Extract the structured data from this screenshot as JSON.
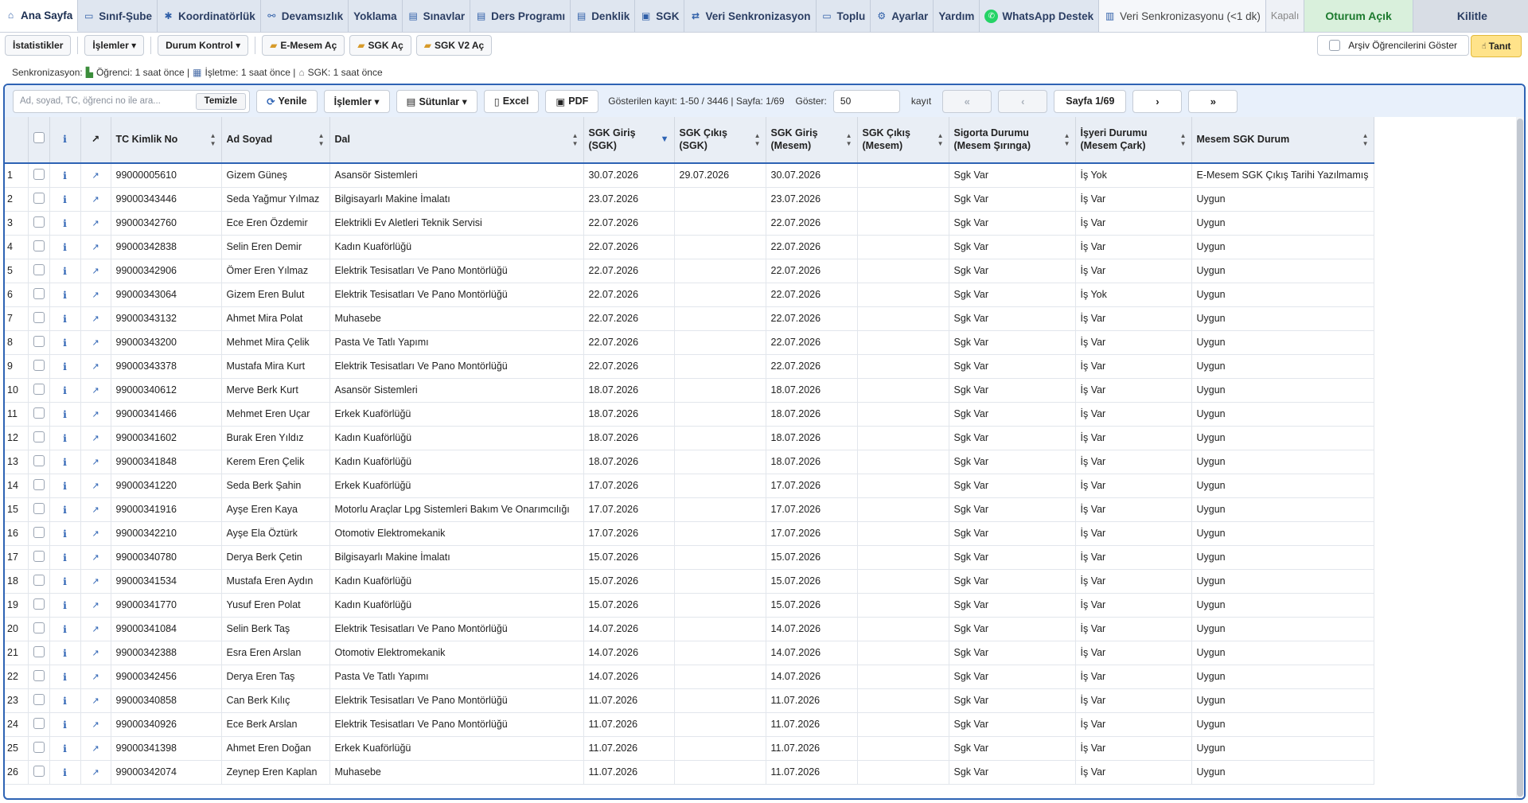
{
  "tabs": [
    {
      "label": "Ana Sayfa",
      "icon": "home-icon",
      "sym": "⌂",
      "style": "active"
    },
    {
      "label": "Sınıf-Şube",
      "icon": "classroom-icon",
      "sym": "▭",
      "style": ""
    },
    {
      "label": "Koordinatörlük",
      "icon": "gear-icon",
      "sym": "✱",
      "style": ""
    },
    {
      "label": "Devamsızlık",
      "icon": "attendance-icon",
      "sym": "⚯",
      "style": ""
    },
    {
      "label": "Yoklama",
      "icon": "",
      "sym": "",
      "style": ""
    },
    {
      "label": "Sınavlar",
      "icon": "document-icon",
      "sym": "▤",
      "style": ""
    },
    {
      "label": "Ders Programı",
      "icon": "document-icon",
      "sym": "▤",
      "style": ""
    },
    {
      "label": "Denklik",
      "icon": "document-icon",
      "sym": "▤",
      "style": ""
    },
    {
      "label": "SGK",
      "icon": "card-icon",
      "sym": "▣",
      "style": ""
    },
    {
      "label": "Veri Senkronizasyon",
      "icon": "sync-icon",
      "sym": "⇄",
      "style": ""
    },
    {
      "label": "Toplu",
      "icon": "message-icon",
      "sym": "▭",
      "style": ""
    },
    {
      "label": "Ayarlar",
      "icon": "settings-icon",
      "sym": "⚙",
      "style": ""
    },
    {
      "label": "Yardım",
      "icon": "",
      "sym": "",
      "style": ""
    },
    {
      "label": "WhatsApp Destek",
      "icon": "whatsapp-icon",
      "sym": "✆",
      "style": "wa"
    },
    {
      "label": "Veri Senkronizasyonu (<1 dk)",
      "icon": "chart-icon",
      "sym": "▥",
      "style": "plain"
    },
    {
      "label": "Kapalı",
      "icon": "",
      "sym": "",
      "style": "muted"
    },
    {
      "label": "Oturum Açık",
      "icon": "",
      "sym": "",
      "style": "green"
    },
    {
      "label": "Kilitle",
      "icon": "",
      "sym": "",
      "style": "lock"
    }
  ],
  "toolbar": {
    "istatistikler": "İstatistikler",
    "islemler": "İşlemler ▾",
    "durum_kontrol": "Durum Kontrol ▾",
    "emesem": "E-Mesem Aç",
    "sgk": "SGK Aç",
    "sgk_v2": "SGK V2 Aç",
    "archive": "Arşiv Öğrencilerini Göster",
    "tanit": "Tanıt"
  },
  "sync": {
    "label": "Senkronizasyon:",
    "ogrenci": "Öğrenci: 1 saat önce |",
    "isletme": "İşletme: 1 saat önce |",
    "sgk": "SGK: 1 saat önce"
  },
  "filter": {
    "search_placeholder": "Ad, soyad, TC, öğrenci no ile ara...",
    "clear": "Temizle",
    "refresh": "Yenile",
    "actions": "İşlemler ▾",
    "columns": "Sütunlar ▾",
    "excel": "Excel",
    "pdf": "PDF",
    "records_info": "Gösterilen kayıt: 1-50 / 3446 | Sayfa: 1/69",
    "show_label": "Göster:",
    "page_size": "50",
    "kayit": "kayıt",
    "first": "«",
    "prev": "‹",
    "page": "Sayfa 1/69",
    "next": "›",
    "last": "»"
  },
  "columns": {
    "info": "i",
    "open": "↗",
    "tc": "TC Kimlik No",
    "name": "Ad Soyad",
    "dal": "Dal",
    "sgk_giris": "SGK Giriş (SGK)",
    "sgk_cikis": "SGK Çıkış (SGK)",
    "sgk_giris_m": "SGK Giriş (Mesem)",
    "sgk_cikis_m": "SGK Çıkış (Mesem)",
    "sigorta": "Sigorta Durumu (Mesem Şırınga)",
    "isyeri": "İşyeri Durumu (Mesem Çark)",
    "mesem_sgk": "Mesem SGK Durum"
  },
  "rows": [
    [
      "1",
      "99000005610",
      "Gizem Güneş",
      "Asansör Sistemleri",
      "30.07.2026",
      "29.07.2026",
      "30.07.2026",
      "",
      "Sgk Var",
      "İş Yok",
      "E-Mesem SGK Çıkış Tarihi Yazılmamış"
    ],
    [
      "2",
      "99000343446",
      "Seda Yağmur Yılmaz",
      "Bilgisayarlı Makine İmalatı",
      "23.07.2026",
      "",
      "23.07.2026",
      "",
      "Sgk Var",
      "İş Var",
      "Uygun"
    ],
    [
      "3",
      "99000342760",
      "Ece Eren Özdemir",
      "Elektrikli Ev Aletleri Teknik Servisi",
      "22.07.2026",
      "",
      "22.07.2026",
      "",
      "Sgk Var",
      "İş Var",
      "Uygun"
    ],
    [
      "4",
      "99000342838",
      "Selin Eren Demir",
      "Kadın Kuaförlüğü",
      "22.07.2026",
      "",
      "22.07.2026",
      "",
      "Sgk Var",
      "İş Var",
      "Uygun"
    ],
    [
      "5",
      "99000342906",
      "Ömer Eren Yılmaz",
      "Elektrik Tesisatları Ve Pano Montörlüğü",
      "22.07.2026",
      "",
      "22.07.2026",
      "",
      "Sgk Var",
      "İş Var",
      "Uygun"
    ],
    [
      "6",
      "99000343064",
      "Gizem Eren Bulut",
      "Elektrik Tesisatları Ve Pano Montörlüğü",
      "22.07.2026",
      "",
      "22.07.2026",
      "",
      "Sgk Var",
      "İş Yok",
      "Uygun"
    ],
    [
      "7",
      "99000343132",
      "Ahmet Mira Polat",
      "Muhasebe",
      "22.07.2026",
      "",
      "22.07.2026",
      "",
      "Sgk Var",
      "İş Var",
      "Uygun"
    ],
    [
      "8",
      "99000343200",
      "Mehmet Mira Çelik",
      "Pasta Ve Tatlı Yapımı",
      "22.07.2026",
      "",
      "22.07.2026",
      "",
      "Sgk Var",
      "İş Var",
      "Uygun"
    ],
    [
      "9",
      "99000343378",
      "Mustafa Mira Kurt",
      "Elektrik Tesisatları Ve Pano Montörlüğü",
      "22.07.2026",
      "",
      "22.07.2026",
      "",
      "Sgk Var",
      "İş Var",
      "Uygun"
    ],
    [
      "10",
      "99000340612",
      "Merve Berk Kurt",
      "Asansör Sistemleri",
      "18.07.2026",
      "",
      "18.07.2026",
      "",
      "Sgk Var",
      "İş Var",
      "Uygun"
    ],
    [
      "11",
      "99000341466",
      "Mehmet Eren Uçar",
      "Erkek Kuaförlüğü",
      "18.07.2026",
      "",
      "18.07.2026",
      "",
      "Sgk Var",
      "İş Var",
      "Uygun"
    ],
    [
      "12",
      "99000341602",
      "Burak Eren Yıldız",
      "Kadın Kuaförlüğü",
      "18.07.2026",
      "",
      "18.07.2026",
      "",
      "Sgk Var",
      "İş Var",
      "Uygun"
    ],
    [
      "13",
      "99000341848",
      "Kerem Eren Çelik",
      "Kadın Kuaförlüğü",
      "18.07.2026",
      "",
      "18.07.2026",
      "",
      "Sgk Var",
      "İş Var",
      "Uygun"
    ],
    [
      "14",
      "99000341220",
      "Seda Berk Şahin",
      "Erkek Kuaförlüğü",
      "17.07.2026",
      "",
      "17.07.2026",
      "",
      "Sgk Var",
      "İş Var",
      "Uygun"
    ],
    [
      "15",
      "99000341916",
      "Ayşe Eren Kaya",
      "Motorlu Araçlar Lpg Sistemleri Bakım Ve Onarımcılığı",
      "17.07.2026",
      "",
      "17.07.2026",
      "",
      "Sgk Var",
      "İş Var",
      "Uygun"
    ],
    [
      "16",
      "99000342210",
      "Ayşe Ela Öztürk",
      "Otomotiv Elektromekanik",
      "17.07.2026",
      "",
      "17.07.2026",
      "",
      "Sgk Var",
      "İş Var",
      "Uygun"
    ],
    [
      "17",
      "99000340780",
      "Derya Berk Çetin",
      "Bilgisayarlı Makine İmalatı",
      "15.07.2026",
      "",
      "15.07.2026",
      "",
      "Sgk Var",
      "İş Var",
      "Uygun"
    ],
    [
      "18",
      "99000341534",
      "Mustafa Eren Aydın",
      "Kadın Kuaförlüğü",
      "15.07.2026",
      "",
      "15.07.2026",
      "",
      "Sgk Var",
      "İş Var",
      "Uygun"
    ],
    [
      "19",
      "99000341770",
      "Yusuf Eren Polat",
      "Kadın Kuaförlüğü",
      "15.07.2026",
      "",
      "15.07.2026",
      "",
      "Sgk Var",
      "İş Var",
      "Uygun"
    ],
    [
      "20",
      "99000341084",
      "Selin Berk Taş",
      "Elektrik Tesisatları Ve Pano Montörlüğü",
      "14.07.2026",
      "",
      "14.07.2026",
      "",
      "Sgk Var",
      "İş Var",
      "Uygun"
    ],
    [
      "21",
      "99000342388",
      "Esra Eren Arslan",
      "Otomotiv Elektromekanik",
      "14.07.2026",
      "",
      "14.07.2026",
      "",
      "Sgk Var",
      "İş Var",
      "Uygun"
    ],
    [
      "22",
      "99000342456",
      "Derya Eren Taş",
      "Pasta Ve Tatlı Yapımı",
      "14.07.2026",
      "",
      "14.07.2026",
      "",
      "Sgk Var",
      "İş Var",
      "Uygun"
    ],
    [
      "23",
      "99000340858",
      "Can Berk Kılıç",
      "Elektrik Tesisatları Ve Pano Montörlüğü",
      "11.07.2026",
      "",
      "11.07.2026",
      "",
      "Sgk Var",
      "İş Var",
      "Uygun"
    ],
    [
      "24",
      "99000340926",
      "Ece Berk Arslan",
      "Elektrik Tesisatları Ve Pano Montörlüğü",
      "11.07.2026",
      "",
      "11.07.2026",
      "",
      "Sgk Var",
      "İş Var",
      "Uygun"
    ],
    [
      "25",
      "99000341398",
      "Ahmet Eren Doğan",
      "Erkek Kuaförlüğü",
      "11.07.2026",
      "",
      "11.07.2026",
      "",
      "Sgk Var",
      "İş Var",
      "Uygun"
    ],
    [
      "26",
      "99000342074",
      "Zeynep Eren Kaplan",
      "Muhasebe",
      "11.07.2026",
      "",
      "11.07.2026",
      "",
      "Sgk Var",
      "İş Var",
      "Uygun"
    ]
  ],
  "colors": {
    "accent": "#2e63b4",
    "header_bg": "#e9eef5",
    "tanit": "#ffe38a",
    "session_green": "#1c7a2e"
  }
}
